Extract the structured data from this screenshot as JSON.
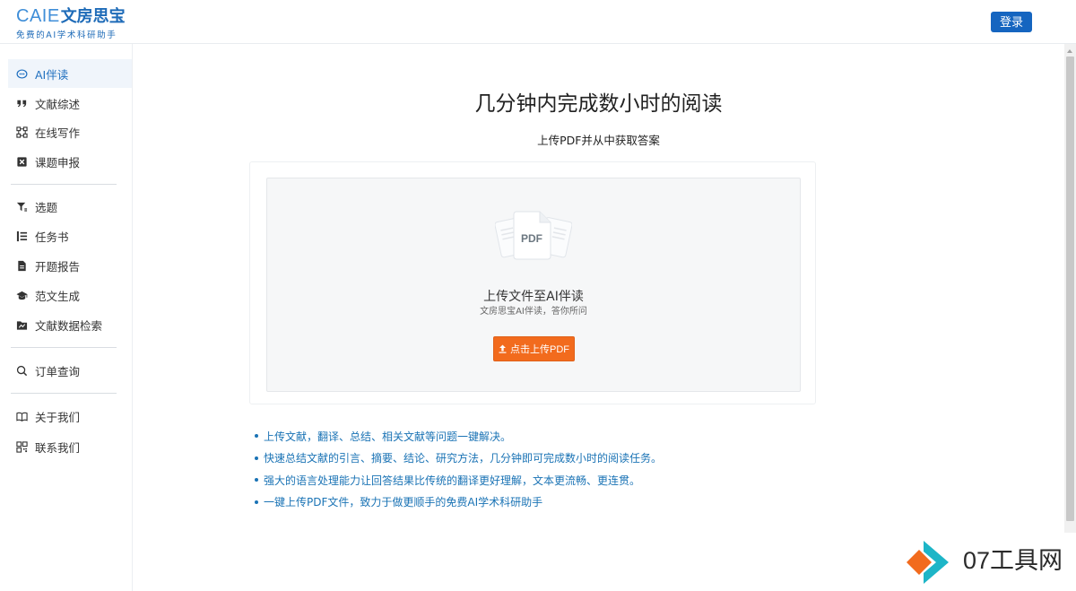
{
  "header": {
    "logo_en": "CAIE",
    "logo_cn": "文房思宝",
    "logo_sub": "免费的AI学术科研助手",
    "login_label": "登录"
  },
  "sidebar": {
    "groups": [
      [
        {
          "label": "AI伴读",
          "icon": "chat-bubble-icon",
          "active": true
        },
        {
          "label": "文献综述",
          "icon": "quote-icon"
        },
        {
          "label": "在线写作",
          "icon": "nodes-icon"
        },
        {
          "label": "课题申报",
          "icon": "cross-square-icon"
        }
      ],
      [
        {
          "label": "选题",
          "icon": "filter-icon"
        },
        {
          "label": "任务书",
          "icon": "list-icon"
        },
        {
          "label": "开题报告",
          "icon": "document-icon"
        },
        {
          "label": "范文生成",
          "icon": "graduation-cap-icon"
        },
        {
          "label": "文献数据检索",
          "icon": "folder-chart-icon"
        }
      ],
      [
        {
          "label": "订单查询",
          "icon": "search-icon"
        }
      ],
      [
        {
          "label": "关于我们",
          "icon": "book-open-icon"
        },
        {
          "label": "联系我们",
          "icon": "qrcode-icon"
        }
      ]
    ]
  },
  "main": {
    "title": "几分钟内完成数小时的阅读",
    "subtitle": "上传PDF并从中获取答案",
    "upload": {
      "file_label": "PDF",
      "title": "上传文件至AI伴读",
      "desc": "文房思宝AI伴读，答你所问",
      "button_label": "点击上传PDF"
    },
    "features": [
      "上传文献，翻译、总结、相关文献等问题一键解决。",
      "快速总结文献的引言、摘要、结论、研究方法，几分钟即可完成数小时的阅读任务。",
      "强大的语言处理能力让回答结果比传统的翻译更好理解，文本更流畅、更连贯。",
      "一键上传PDF文件，致力于做更顺手的免费AI学术科研助手"
    ]
  },
  "watermark": {
    "text": "07工具网"
  },
  "colors": {
    "brand_blue": "#1565c0",
    "active_blue": "#1f6fbf",
    "accent_orange": "#f26b1d",
    "feature_blue": "#1a73b5"
  }
}
